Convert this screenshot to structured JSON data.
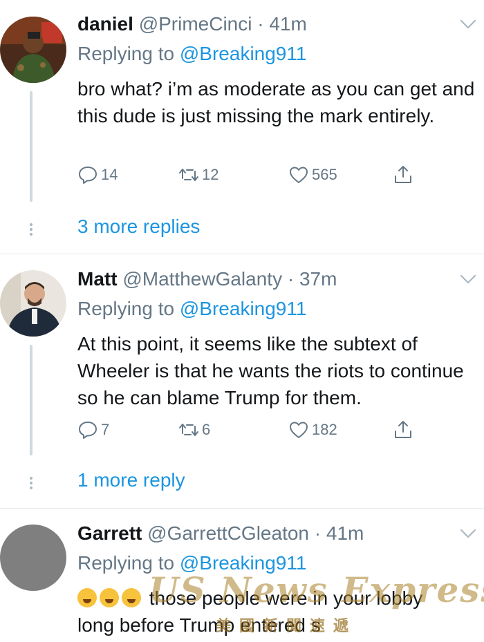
{
  "tweets": [
    {
      "name": "daniel",
      "handle": "@PrimeCinci",
      "time": "· 41m",
      "replying_prefix": "Replying to ",
      "replying_to": "@Breaking911",
      "text": "bro what? i’m as moderate as you can get and this dude is just missing the mark entirely.",
      "replies": "14",
      "retweets": "12",
      "likes": "565",
      "more_replies": "3 more replies"
    },
    {
      "name": "Matt",
      "handle": "@MatthewGalanty",
      "time": "· 37m",
      "replying_prefix": "Replying to ",
      "replying_to": "@Breaking911",
      "text": "At this point, it seems like the subtext of Wheeler is that he wants the riots to continue so he can blame Trump for them.",
      "replies": "7",
      "retweets": "6",
      "likes": "182",
      "more_replies": "1 more reply"
    },
    {
      "name": "Garrett",
      "handle": "@GarrettCGleaton",
      "time": "· 41m",
      "replying_prefix": "Replying to ",
      "replying_to": "@Breaking911",
      "text_line1": " those people were in your lobby",
      "text_line2": "long before Trump entered s"
    }
  ],
  "watermark": {
    "title": "US News Express",
    "subtitle": "美國新聞速遞"
  },
  "colors": {
    "link": "#1b95e0",
    "secondary": "#657786",
    "divider": "#e1e8ed"
  }
}
